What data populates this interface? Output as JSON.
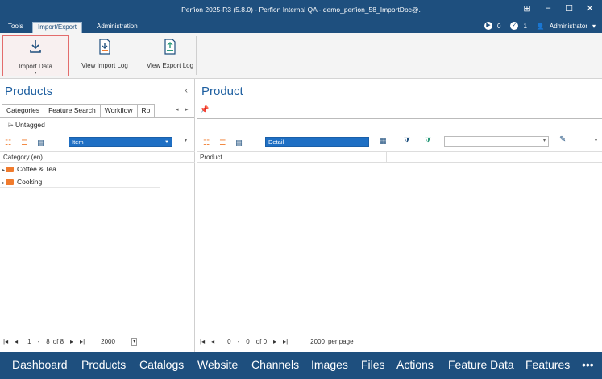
{
  "window": {
    "title": "Perfion 2025-R3 (5.8.0) - Perfion Internal QA - demo_perfion_58_ImportDoc@.",
    "controls": [
      "⊞",
      "–",
      "☐",
      "✕"
    ]
  },
  "menu": {
    "tabs": [
      "Tools",
      "Import/Export",
      "Administration"
    ],
    "status": {
      "running": "0",
      "done": "1",
      "user": "Administrator"
    }
  },
  "ribbon": {
    "import_data": "Import Data",
    "view_import_log": "View Import Log",
    "view_export_log": "View Export Log"
  },
  "left": {
    "title": "Products",
    "tabs": [
      "Categories",
      "Feature Search",
      "Workflow",
      "Ro"
    ],
    "untagged": "Untagged",
    "view_combo": "Item",
    "column": "Category (en)",
    "rows": [
      "Coffee & Tea",
      "Cooking"
    ],
    "pager": {
      "current": "1",
      "dash": "-",
      "to": "8",
      "of": "of 8",
      "size": "2000"
    }
  },
  "right": {
    "title": "Product",
    "view_combo": "Detail",
    "filter_combo": "",
    "column": "Product",
    "pager": {
      "from": "0",
      "dash": "-",
      "to": "0",
      "of": "of 0",
      "size": "2000",
      "per_page": "per page"
    }
  },
  "nav": [
    "Dashboard",
    "Products",
    "Catalogs",
    "Website",
    "Channels",
    "Images",
    "Files",
    "Actions",
    "Feature Data",
    "Features",
    "•••"
  ],
  "colors": {
    "brand": "#1e4f7e",
    "accent": "#1e6fc4",
    "folder": "#f07b2d",
    "selected_border": "#e36c6c"
  }
}
